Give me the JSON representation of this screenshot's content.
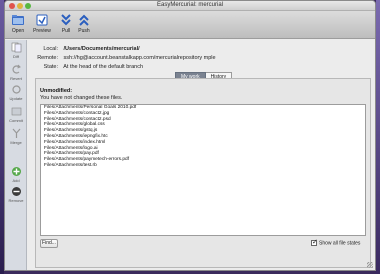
{
  "window": {
    "title": "EasyMercurial: mercurial"
  },
  "toolbar": [
    {
      "id": "open",
      "label": "Open",
      "icon": "open-folder-icon"
    },
    {
      "id": "preview",
      "label": "Preview",
      "icon": "preview-icon"
    },
    {
      "id": "pull",
      "label": "Pull",
      "icon": "pull-icon"
    },
    {
      "id": "push",
      "label": "Push",
      "icon": "push-icon"
    }
  ],
  "sidebar": [
    {
      "id": "diff",
      "label": "Diff",
      "icon": "diff-icon"
    },
    {
      "id": "revert",
      "label": "Revert",
      "icon": "revert-icon"
    },
    {
      "id": "update",
      "label": "Update",
      "icon": "update-icon"
    },
    {
      "id": "commit",
      "label": "Commit",
      "icon": "commit-icon"
    },
    {
      "id": "merge",
      "label": "Merge",
      "icon": "merge-icon"
    },
    {
      "id": "add",
      "label": "Add",
      "icon": "add-icon"
    },
    {
      "id": "remove",
      "label": "Remove",
      "icon": "remove-icon"
    }
  ],
  "info": {
    "local_label": "Local:",
    "local_value": "/Users/Documents/mercurial/",
    "remote_label": "Remote:",
    "remote_value": "ssh://hg@account.beanstalkapp.com/mercurialrepository mple",
    "state_label": "State:",
    "state_value": "At the head of the default branch"
  },
  "tabs": [
    {
      "label": "My work",
      "active": true
    },
    {
      "label": "History",
      "active": false
    }
  ],
  "panel": {
    "title": "Unmodified:",
    "description": "You have not changed these files.",
    "files": [
      "Files/Attachments/Personal Goals 2010.pdf",
      "Files/Attachments/contact2.jpg",
      "Files/Attachments/contact2.psd",
      "Files/Attachments/global.css",
      "Files/Attachments/gstq.js",
      "Files/Attachments/iepngfix.htc",
      "Files/Attachments/index.html",
      "Files/Attachments/logo.ai",
      "Files/Attachments/pay.pdf",
      "Files/Attachments/paymetech-errors.pdf",
      "Files/Attachments/test.rb"
    ],
    "find_label": "Find...",
    "show_all_label": "Show all file states",
    "show_all_checked": true
  }
}
